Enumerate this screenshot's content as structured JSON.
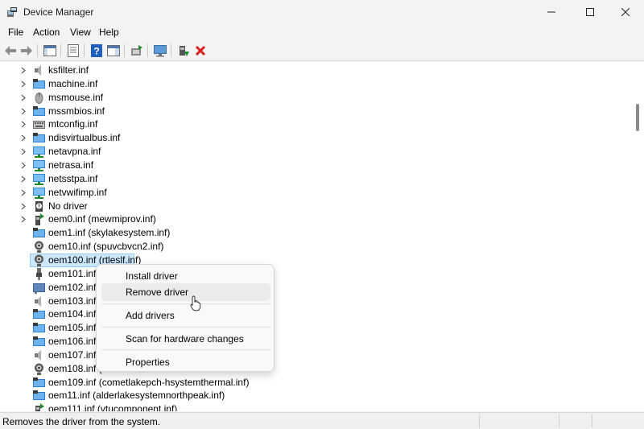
{
  "window": {
    "title": "Device Manager",
    "minimize_icon": "minimize-icon",
    "maximize_icon": "maximize-icon",
    "close_icon": "close-icon"
  },
  "menu": [
    "File",
    "Action",
    "View",
    "Help"
  ],
  "toolbar": {
    "buttons": [
      "back-arrow-icon",
      "forward-arrow-icon",
      "show-hide-console-tree-icon",
      "properties-icon",
      "help-icon",
      "action-pane-icon",
      "update-driver-icon",
      "monitor-icon",
      "add-driver-icon",
      "uninstall-x-icon"
    ],
    "accent_colors": {
      "help": "#1f5fbf",
      "remove": "#d9201c",
      "add": "#1f8a2e"
    }
  },
  "tree": {
    "items": [
      {
        "label": "ksfilter.inf",
        "icon": "speaker-icon",
        "expandable": true
      },
      {
        "label": "machine.inf",
        "icon": "computer-icon",
        "expandable": true
      },
      {
        "label": "msmouse.inf",
        "icon": "mouse-icon",
        "expandable": true
      },
      {
        "label": "mssmbios.inf",
        "icon": "computer-icon",
        "expandable": true
      },
      {
        "label": "mtconfig.inf",
        "icon": "keyboard-icon",
        "expandable": true
      },
      {
        "label": "ndisvirtualbus.inf",
        "icon": "computer-icon",
        "expandable": true
      },
      {
        "label": "netavpna.inf",
        "icon": "network-monitor-icon",
        "expandable": true
      },
      {
        "label": "netrasa.inf",
        "icon": "network-monitor-icon",
        "expandable": true
      },
      {
        "label": "netsstpa.inf",
        "icon": "network-monitor-icon",
        "expandable": true
      },
      {
        "label": "netvwifimp.inf",
        "icon": "network-monitor-icon",
        "expandable": true
      },
      {
        "label": "No driver",
        "icon": "unknown-device-icon",
        "expandable": true
      },
      {
        "label": "oem0.inf (mewmiprov.inf)",
        "icon": "device-plug-icon",
        "expandable": true
      },
      {
        "label": "oem1.inf (skylakesystem.inf)",
        "icon": "computer-icon",
        "expandable": false
      },
      {
        "label": "oem10.inf (spuvcbvcn2.inf)",
        "icon": "webcam-icon",
        "expandable": false
      },
      {
        "label": "oem100.inf (rtleslf.inf)",
        "icon": "webcam-icon",
        "expandable": false,
        "selected": true
      },
      {
        "label": "oem101.inf (",
        "icon": "usb-plug-icon",
        "expandable": false
      },
      {
        "label": "oem102.inf (",
        "icon": "display-adapter-icon",
        "expandable": false
      },
      {
        "label": "oem103.inf (",
        "icon": "speaker-icon",
        "expandable": false
      },
      {
        "label": "oem104.inf (",
        "icon": "computer-icon",
        "expandable": false
      },
      {
        "label": "oem105.inf (",
        "icon": "computer-icon",
        "expandable": false
      },
      {
        "label": "oem106.inf (",
        "icon": "computer-icon",
        "expandable": false
      },
      {
        "label": "oem107.inf (",
        "icon": "speaker-icon",
        "expandable": false
      },
      {
        "label": "oem108.inf (",
        "icon": "webcam-icon",
        "expandable": false
      },
      {
        "label": "oem109.inf (cometlakepch-hsystemthermal.inf)",
        "icon": "computer-icon",
        "expandable": false
      },
      {
        "label": "oem11.inf (alderlakesystemnorthpeak.inf)",
        "icon": "computer-icon",
        "expandable": false
      },
      {
        "label": "oem111.inf (vtucomponent.inf)",
        "icon": "device-plug-icon",
        "expandable": false
      }
    ]
  },
  "context_menu": {
    "items": [
      "Install driver",
      "Remove driver",
      "Add drivers",
      "Scan for hardware changes",
      "Properties"
    ],
    "hovered": "Remove driver"
  },
  "status": {
    "text": "Removes the driver from the system."
  }
}
